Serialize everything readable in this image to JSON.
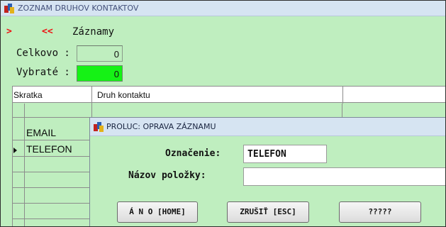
{
  "main_window": {
    "title": "ZOZNAM DRUHOV KONTAKTOV",
    "nav_next": ">",
    "nav_prev": "<<",
    "records_label": "Záznamy",
    "total_label": "Celkovo :",
    "total_value": "0",
    "selected_label": "Vybraté :",
    "selected_value": "0"
  },
  "grid": {
    "columns": [
      "Skratka",
      "Druh kontaktu"
    ],
    "rows": [
      {
        "code": "",
        "type": ""
      },
      {
        "code": "EMAIL",
        "type": ""
      },
      {
        "code": "TELEFON",
        "type": ""
      }
    ]
  },
  "dialog": {
    "title": "PROLUC: OPRAVA ZÁZNAMU",
    "fields": {
      "designation_label": "Označenie:",
      "designation_value": "TELEFON",
      "item_name_label": "Názov položky:",
      "item_name_value": ""
    },
    "buttons": {
      "yes": "Á N O [HOME]",
      "cancel": "ZRUŠIŤ [ESC]",
      "unknown": "?????"
    }
  },
  "colors": {
    "window_bg": "#bfeebf",
    "selected_count_bg": "#15f215",
    "title_bar": "#d6e4f2",
    "nav_arrow": "#ee1111"
  }
}
